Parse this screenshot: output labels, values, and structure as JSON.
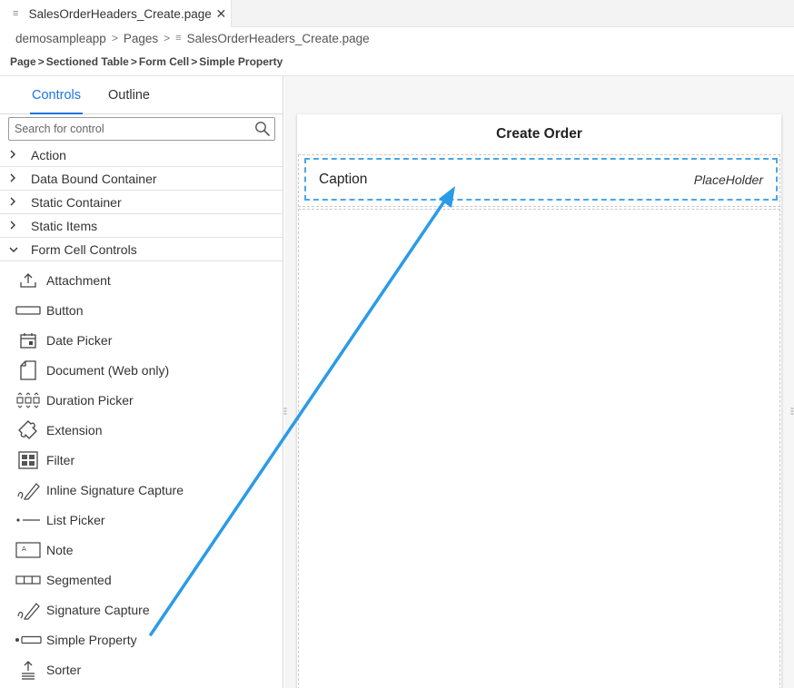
{
  "tab": {
    "title": "SalesOrderHeaders_Create.page"
  },
  "breadcrumb": {
    "app": "demosampleapp",
    "folder": "Pages",
    "file": "SalesOrderHeaders_Create.page"
  },
  "path": {
    "p1": "Page",
    "p2": "Sectioned Table",
    "p3": "Form Cell",
    "p4": "Simple Property"
  },
  "panel": {
    "tabs": [
      "Controls",
      "Outline"
    ],
    "search_placeholder": "Search for control",
    "groups": [
      {
        "label": "Action",
        "expanded": false
      },
      {
        "label": "Data Bound Container",
        "expanded": false
      },
      {
        "label": "Static Container",
        "expanded": false
      },
      {
        "label": "Static Items",
        "expanded": false
      },
      {
        "label": "Form Cell Controls",
        "expanded": true
      }
    ],
    "items": [
      {
        "label": "Attachment",
        "icon": "upload-icon"
      },
      {
        "label": "Button",
        "icon": "button-icon"
      },
      {
        "label": "Date Picker",
        "icon": "calendar-icon"
      },
      {
        "label": "Document (Web only)",
        "icon": "document-icon"
      },
      {
        "label": "Duration Picker",
        "icon": "duration-icon"
      },
      {
        "label": "Extension",
        "icon": "puzzle-icon"
      },
      {
        "label": "Filter",
        "icon": "grid-icon"
      },
      {
        "label": "Inline Signature Capture",
        "icon": "signature-icon"
      },
      {
        "label": "List Picker",
        "icon": "list-picker-icon"
      },
      {
        "label": "Note",
        "icon": "note-icon"
      },
      {
        "label": "Segmented",
        "icon": "segmented-icon"
      },
      {
        "label": "Signature Capture",
        "icon": "signature-icon"
      },
      {
        "label": "Simple Property",
        "icon": "simple-property-icon"
      },
      {
        "label": "Sorter",
        "icon": "sorter-icon"
      }
    ]
  },
  "canvas": {
    "page_title": "Create Order",
    "cell": {
      "caption": "Caption",
      "placeholder": "PlaceHolder"
    }
  },
  "colors": {
    "accent": "#1e73e8",
    "arrow": "#2a9be8",
    "selection": "#4aa6e6"
  }
}
